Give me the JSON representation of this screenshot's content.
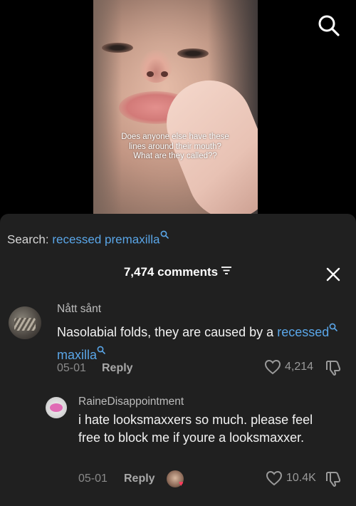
{
  "video": {
    "caption": "Does anyone else have these lines around their mouth? What are they called??"
  },
  "icons": {
    "top_search": "search-icon",
    "filter": "filter-icon",
    "close": "close-icon",
    "like": "heart-outline-icon",
    "dislike": "thumbs-down-icon"
  },
  "search": {
    "label": "Search:",
    "term": "recessed premaxilla"
  },
  "comments_header": {
    "count_label": "7,474 comments"
  },
  "comments": [
    {
      "username": "Nått sånt",
      "text_plain": "Nasolabial folds, they are caused by a",
      "link1": "recessed",
      "link2": "maxilla",
      "date": "05-01",
      "reply_label": "Reply",
      "likes": "4,214"
    },
    {
      "username": "RaineDisappointment",
      "text": "i hate looksmaxxers so much. please feel free to block me if youre a looksmaxxer.",
      "date": "05-01",
      "reply_label": "Reply",
      "likes": "10.4K"
    }
  ],
  "colors": {
    "link_blue": "#5aa6e8",
    "panel_bg": "#202020",
    "liked_heart": "#ff3b5c"
  }
}
